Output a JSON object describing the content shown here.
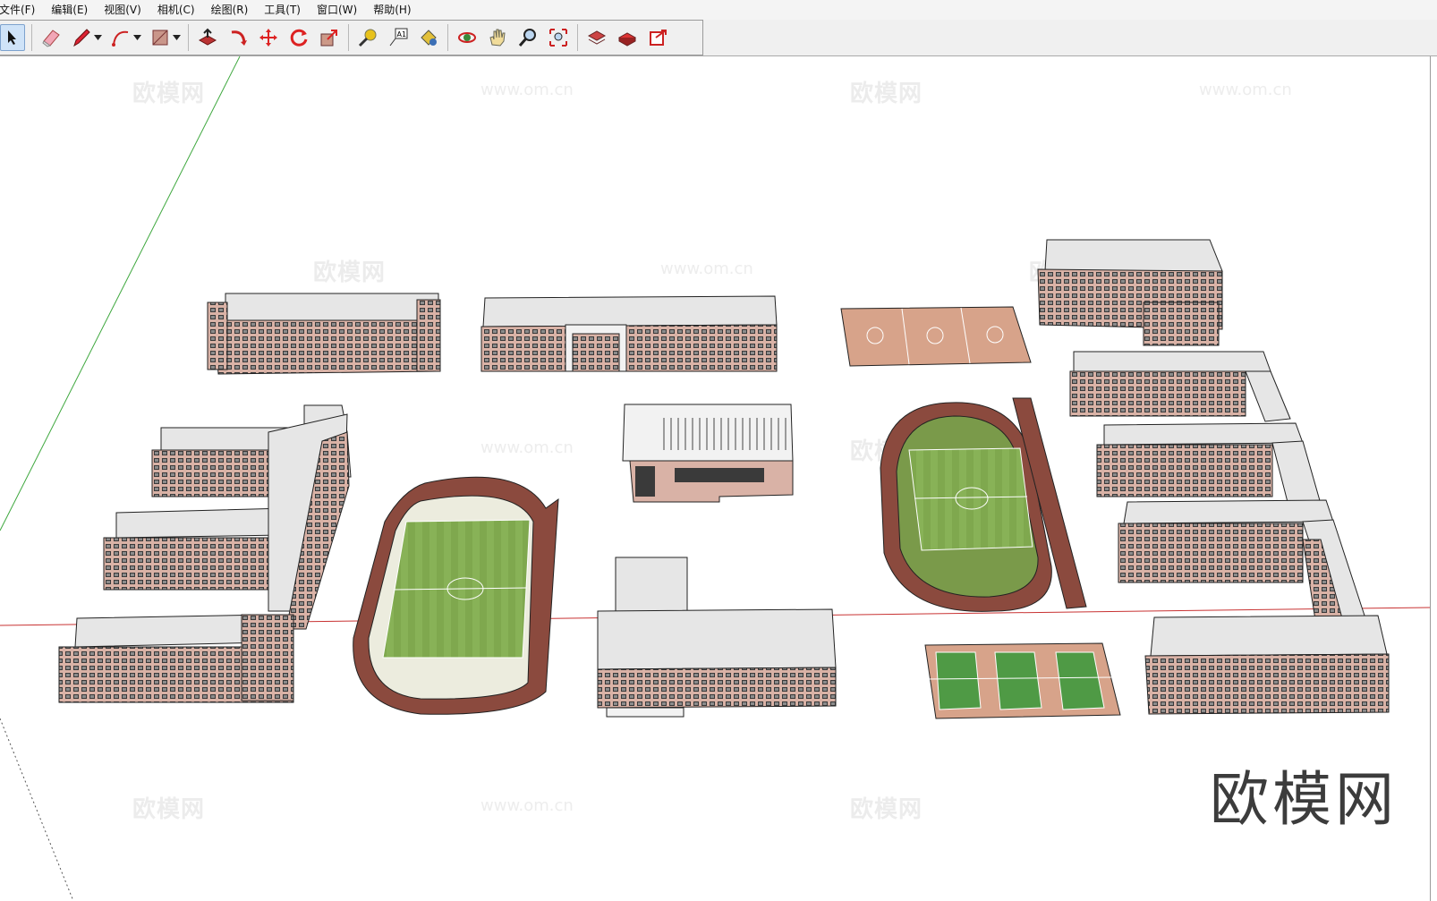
{
  "menu": {
    "items": [
      "文件(F)",
      "编辑(E)",
      "视图(V)",
      "相机(C)",
      "绘图(R)",
      "工具(T)",
      "窗口(W)",
      "帮助(H)"
    ]
  },
  "toolbar": {
    "tools": [
      "select-icon",
      "eraser-icon",
      "pencil-icon",
      "arc-icon",
      "rectangle-icon",
      "push-pull-icon",
      "follow-me-icon",
      "move-icon",
      "rotate-icon",
      "scale-icon",
      "tape-measure-icon",
      "text-icon",
      "paint-bucket-icon",
      "orbit-icon",
      "pan-icon",
      "zoom-icon",
      "zoom-extents-icon",
      "section-icon",
      "component-icon",
      "export-icon"
    ]
  },
  "watermarks": {
    "brand": "欧模网",
    "url": "www.om.cn"
  },
  "logo": {
    "text": "欧模网"
  },
  "colors": {
    "selected": "#cfe3f8",
    "green_axis": "#3fa83f",
    "red_axis": "#c83232",
    "field": "#7fa84e",
    "track": "#8b4a3e",
    "court": "#d7a38a",
    "building_wall": "#d9b2a6",
    "roof": "#e6e6e6"
  }
}
